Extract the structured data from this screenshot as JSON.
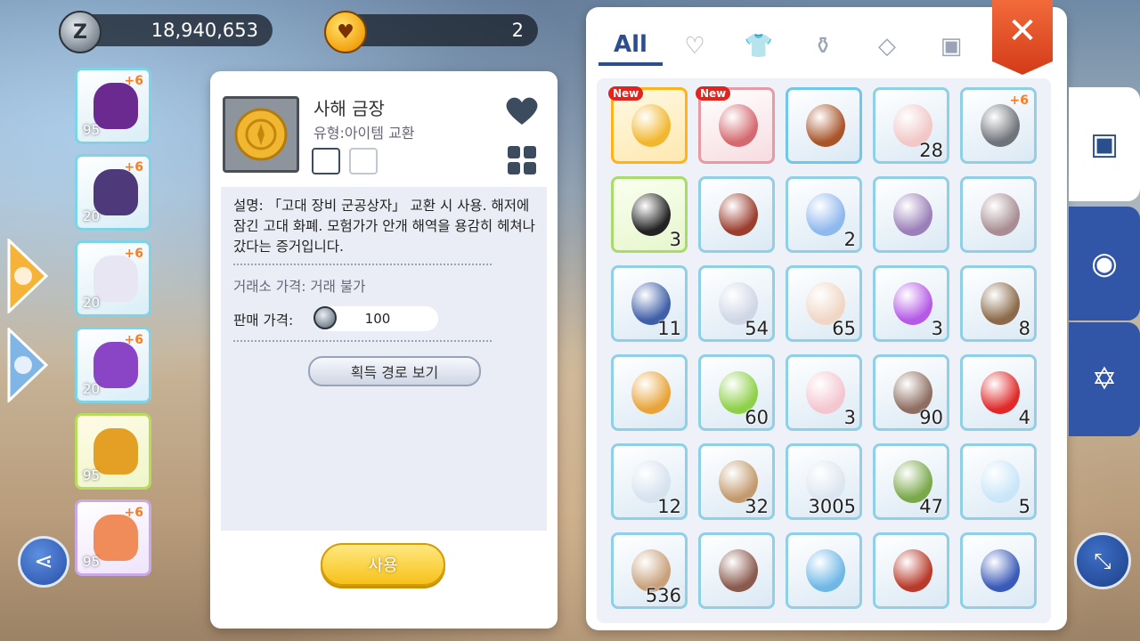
{
  "currency": {
    "zeny": "18,940,653",
    "zeny_icon": "Z",
    "friendship": "2"
  },
  "equipment": [
    {
      "level": "95",
      "refine": "+6",
      "color": "#6a2a8f"
    },
    {
      "level": "20",
      "refine": "+6",
      "color": "#4e3a7a"
    },
    {
      "level": "20",
      "refine": "+6",
      "color": "#e8e6f2"
    },
    {
      "level": "20",
      "refine": "+6",
      "color": "#8a45c6"
    },
    {
      "level": "95",
      "refine": "",
      "color": "#e4a024"
    },
    {
      "level": "95",
      "refine": "+6",
      "color": "#f08b5a"
    }
  ],
  "detail": {
    "title": "사해 금장",
    "type": "유형:아이템 교환",
    "description": "설명: 「고대 장비 군공상자」 교환 시 사용. 해저에 잠긴 고대 화폐. 모험가가 안개 해역을 용감히 헤쳐나갔다는 증거입니다.",
    "exchange_price": "거래소 가격: 거래 불가",
    "sell_label": "판매 가격:",
    "sell_price": "100",
    "path_button": "획득 경로 보기",
    "use_button": "사용"
  },
  "inventory": {
    "tabs": [
      "All",
      "♡",
      "👕",
      "⚱",
      "◇",
      "▣"
    ],
    "close": "✕",
    "new_badge": "New",
    "slots": [
      {
        "count": "",
        "new": true,
        "style": "sel",
        "color": "#f2b730"
      },
      {
        "count": "",
        "new": true,
        "style": "red",
        "color": "#d46a70"
      },
      {
        "count": "",
        "new": false,
        "style": "blue",
        "color": "#a8552a"
      },
      {
        "count": "28",
        "new": false,
        "style": "",
        "color": "#f2c7c7"
      },
      {
        "count": "",
        "new": false,
        "style": "",
        "color": "#6f737a",
        "plus": "+6"
      },
      {
        "count": "3",
        "new": false,
        "style": "green",
        "color": "#222"
      },
      {
        "count": "",
        "new": false,
        "style": "",
        "color": "#9a3e2e"
      },
      {
        "count": "2",
        "new": false,
        "style": "",
        "color": "#8fb8ee"
      },
      {
        "count": "",
        "new": false,
        "style": "",
        "color": "#9a7fb8"
      },
      {
        "count": "",
        "new": false,
        "style": "",
        "color": "#a88e92"
      },
      {
        "count": "11",
        "new": false,
        "style": "",
        "color": "#3f5fa8"
      },
      {
        "count": "54",
        "new": false,
        "style": "",
        "color": "#cfd6e6"
      },
      {
        "count": "65",
        "new": false,
        "style": "",
        "color": "#f0d6c4"
      },
      {
        "count": "3",
        "new": false,
        "style": "",
        "color": "#b45ae6"
      },
      {
        "count": "8",
        "new": false,
        "style": "",
        "color": "#8a6a4a"
      },
      {
        "count": "",
        "new": false,
        "style": "",
        "color": "#e8a43a"
      },
      {
        "count": "60",
        "new": false,
        "style": "",
        "color": "#8ed04a"
      },
      {
        "count": "3",
        "new": false,
        "style": "",
        "color": "#f4c6d0"
      },
      {
        "count": "90",
        "new": false,
        "style": "",
        "color": "#8e6e62"
      },
      {
        "count": "4",
        "new": false,
        "style": "",
        "color": "#e02a2a"
      },
      {
        "count": "12",
        "new": false,
        "style": "",
        "color": "#d6e2ee"
      },
      {
        "count": "32",
        "new": false,
        "style": "",
        "color": "#c29a6e"
      },
      {
        "count": "3005",
        "new": false,
        "style": "",
        "color": "#dce6f0"
      },
      {
        "count": "47",
        "new": false,
        "style": "",
        "color": "#7aa84a"
      },
      {
        "count": "5",
        "new": false,
        "style": "",
        "color": "#c9e6f8"
      },
      {
        "count": "536",
        "new": false,
        "style": "",
        "color": "#c8a07a"
      },
      {
        "count": "",
        "new": false,
        "style": "",
        "color": "#8a5a4e"
      },
      {
        "count": "",
        "new": false,
        "style": "",
        "color": "#6fb8e6"
      },
      {
        "count": "",
        "new": false,
        "style": "",
        "color": "#b83a2a"
      },
      {
        "count": "",
        "new": false,
        "style": "",
        "color": "#3a5ab8"
      }
    ]
  },
  "side_tabs": [
    "backpack-icon",
    "zeny-bag-icon",
    "magic-circle-icon"
  ]
}
